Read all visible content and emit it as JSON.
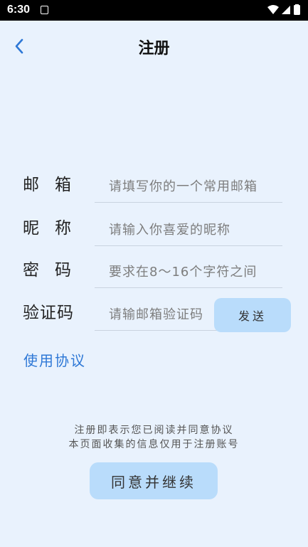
{
  "status_bar": {
    "time": "6:30",
    "notification_icon": "notification-icon",
    "icons": [
      "wifi-icon",
      "signal-icon",
      "battery-icon"
    ]
  },
  "header": {
    "title": "注册",
    "back_icon": "chevron-left-icon"
  },
  "form": {
    "email": {
      "label": "邮箱",
      "placeholder": "请填写你的一个常用邮箱"
    },
    "nickname": {
      "label": "昵称",
      "placeholder": "请输入你喜爱的昵称"
    },
    "password": {
      "label": "密码",
      "placeholder": "要求在8～16个字符之间"
    },
    "code": {
      "label": "验证码",
      "placeholder": "请输邮箱验证码",
      "send_label": "发送"
    }
  },
  "agreement_link": "使用协议",
  "notice": {
    "line1": "注册即表示您已阅读并同意协议",
    "line2": "本页面收集的信息仅用于注册账号"
  },
  "continue_label": "同意并继续",
  "colors": {
    "background": "#e9f2fd",
    "button": "#b9dcfb",
    "link": "#2e78d6",
    "back_arrow": "#2e78d6"
  }
}
